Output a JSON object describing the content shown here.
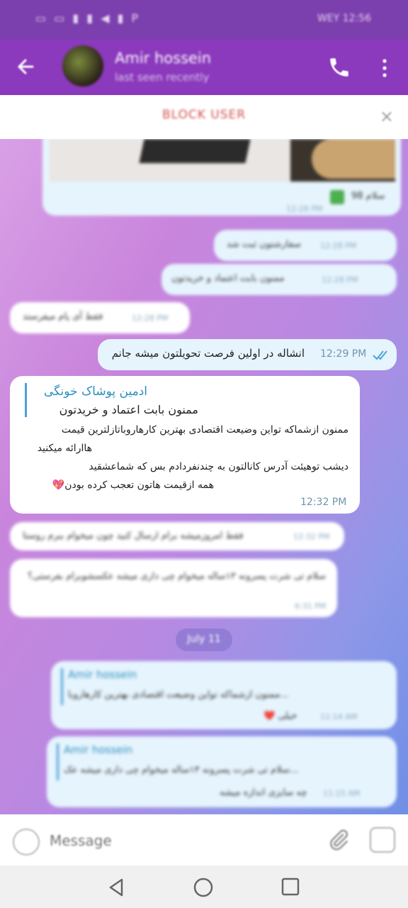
{
  "status_bar": {
    "icons": "▭ ▭ ▮ ▮ ◀ ▮ P",
    "time": "WEY 12:56"
  },
  "header": {
    "contact_name": "Amir hossein",
    "contact_status": "last seen recently",
    "icons": [
      "back-arrow-icon",
      "avatar",
      "phone-icon",
      "more-vert-icon"
    ]
  },
  "block_bar": {
    "label": "BLOCK USER",
    "close": "×"
  },
  "messages": [
    {
      "dir": "out",
      "text": "سلام 98",
      "time": "12:28 PM",
      "blurred": true
    },
    {
      "dir": "out",
      "text": "سفارشتون ثبت شد",
      "time": "12:28 PM",
      "blurred": true
    },
    {
      "dir": "out",
      "text": "ممنون بابت اعتماد و خریدتون",
      "time": "12:28 PM",
      "blurred": true
    },
    {
      "dir": "in",
      "text": "فقط آی پام میفرستد",
      "time": "12:28 PM",
      "blurred": true
    },
    {
      "dir": "out",
      "text": "انشاله در اولین فرصت تحویلتون میشه جانم",
      "time": "12:29 PM",
      "blurred": false
    },
    {
      "dir": "in",
      "reply_sender": "ادمین پوشاک خونگی",
      "reply_text": "ممنون بابت اعتماد و خریدتون",
      "lines": [
        "ممنون ازشماکه تواین وضیعت اقتصادی بهترین کارهاروباتازلترین قیمت",
        "هاارائه میکنید",
        "دیشب توهیئت آدرس کانالتون به چندنفردادم بس که شماعشقید",
        "همه ازقیمت هاتون تعجب کرده بودن💖"
      ],
      "time": "12:32 PM",
      "blurred": false
    },
    {
      "dir": "in",
      "text": "فقط امروزمیشه برام ارسال کنید چون میخوام ببرم روستا",
      "time": "12:32 PM",
      "blurred": true
    },
    {
      "dir": "in",
      "text": "سلام تی شرت پسرونه ۱۳ساله میخوام چی داری میشه عکسشوبرام بفرستی؟",
      "time": "6:31 PM",
      "blurred": true
    },
    {
      "dir": "out",
      "reply_sender": "Amir hossein",
      "reply_text": "ممنون ازشماکه تواین وضیعت اقتصادی بهترین کارهاروبا...",
      "text": "❤️ خیلی",
      "time": "11:14 AM",
      "blurred": true
    },
    {
      "dir": "out",
      "reply_sender": "Amir hossein",
      "reply_text": "سلام تی شرت پسرونه ۱۳ساله میخوام چی داری میشه عک...",
      "text": "چه سایزی اندازه میشه",
      "time": "11:15 AM",
      "blurred": true
    }
  ],
  "date_divider": "July 11",
  "composer": {
    "placeholder": "Message"
  },
  "nav": {
    "icons": [
      "nav-back-icon",
      "nav-home-icon",
      "nav-recents-icon"
    ]
  }
}
